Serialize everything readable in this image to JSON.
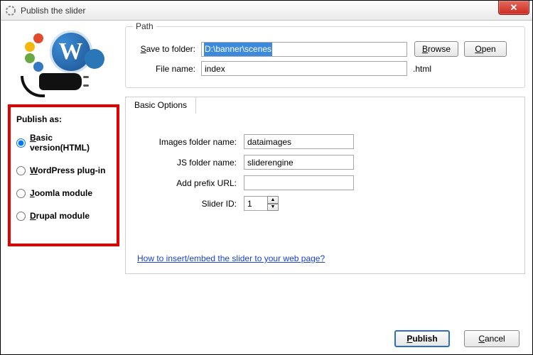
{
  "titlebar": {
    "title": "Publish the slider"
  },
  "sidebar": {
    "heading": "Publish as:",
    "options": [
      {
        "label_pre": "B",
        "label_rest": "asic version(HTML)",
        "checked": true
      },
      {
        "label_pre": "W",
        "label_rest": "ordPress plug-in",
        "checked": false
      },
      {
        "label_pre": "J",
        "label_rest": "oomla module",
        "checked": false
      },
      {
        "label_pre": "D",
        "label_rest": "rupal module",
        "checked": false
      }
    ]
  },
  "path": {
    "legend": "Path",
    "save_to_label_pre": "S",
    "save_to_label_rest": "ave to folder:",
    "save_to_value": "D:\\banner\\scenes",
    "file_name_label": "File name:",
    "file_name_value": "index",
    "file_suffix": ".html",
    "browse_label_pre": "B",
    "browse_label_rest": "rowse",
    "open_label_pre": "O",
    "open_label_rest": "pen"
  },
  "options": {
    "tab_label": "Basic Options",
    "images_label": "Images folder name:",
    "images_value": "dataimages",
    "js_label": "JS folder name:",
    "js_value": "sliderengine",
    "prefix_label": "Add prefix URL:",
    "prefix_value": "",
    "sliderid_label": "Slider ID:",
    "sliderid_value": "1",
    "help_link": "How to insert/embed the slider to your web page?"
  },
  "footer": {
    "publish_label_pre": "P",
    "publish_label_rest": "ublish",
    "cancel_label_pre": "C",
    "cancel_label_rest": "ancel"
  }
}
